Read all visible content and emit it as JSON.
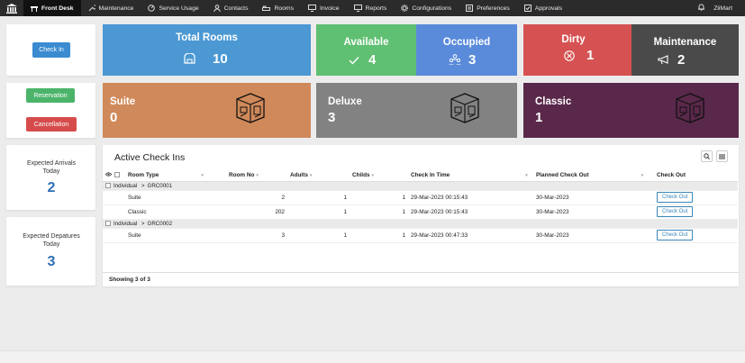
{
  "nav": {
    "items": [
      {
        "label": "Front Desk",
        "icon": "desk-icon"
      },
      {
        "label": "Maintenance",
        "icon": "wrench-icon"
      },
      {
        "label": "Service Usage",
        "icon": "gauge-icon"
      },
      {
        "label": "Contacts",
        "icon": "user-icon"
      },
      {
        "label": "Rooms",
        "icon": "bed-icon"
      },
      {
        "label": "Invoice",
        "icon": "monitor-icon"
      },
      {
        "label": "Reports",
        "icon": "monitor-icon"
      },
      {
        "label": "Configurations",
        "icon": "gear-icon"
      },
      {
        "label": "Preferences",
        "icon": "sliders-icon"
      },
      {
        "label": "Approvals",
        "icon": "checklist-icon"
      }
    ],
    "user": "ZliMart"
  },
  "actions": {
    "checkin": "Check In",
    "reservation": "Reservation",
    "cancellation": "Cancellation"
  },
  "stats": {
    "total_rooms": {
      "label": "Total Rooms",
      "value": "10"
    },
    "available": {
      "label": "Available",
      "value": "4"
    },
    "occupied": {
      "label": "Occupied",
      "value": "3"
    },
    "dirty": {
      "label": "Dirty",
      "value": "1"
    },
    "maintenance": {
      "label": "Maintenance",
      "value": "2"
    }
  },
  "room_types": {
    "suite": {
      "label": "Suite",
      "value": "0"
    },
    "deluxe": {
      "label": "Deluxe",
      "value": "3"
    },
    "classic": {
      "label": "Classic",
      "value": "1"
    }
  },
  "expected": {
    "arrivals_label": "Expected Arrivals Today",
    "arrivals_value": "2",
    "departures_label": "Expected Depatures Today",
    "departures_value": "3"
  },
  "checkins": {
    "title": "Active Check Ins",
    "columns": [
      "Room Type",
      "Room No",
      "Adults",
      "Childs",
      "Check In Time",
      "Planned Check Out",
      "Check Out"
    ],
    "groups": [
      {
        "label": "Individual",
        "sep": ">",
        "code": "GRC0001"
      },
      {
        "label": "Individual",
        "sep": ">",
        "code": "GRC0002"
      }
    ],
    "rows": [
      {
        "room_type": "Suite",
        "room_no": "2",
        "adults": "1",
        "childs": "1",
        "checkin": "29-Mar-2023 00:15:43",
        "planned": "30-Mar-2023",
        "action": "Check Out"
      },
      {
        "room_type": "Classic",
        "room_no": "202",
        "adults": "1",
        "childs": "1",
        "checkin": "29-Mar-2023 00:15:43",
        "planned": "30-Mar-2023",
        "action": "Check Out"
      },
      {
        "room_type": "Suite",
        "room_no": "3",
        "adults": "1",
        "childs": "1",
        "checkin": "29-Mar-2023 00:47:33",
        "planned": "30-Mar-2023",
        "action": "Check Out"
      }
    ],
    "footer": "Showing 3 of 3"
  },
  "colors": {
    "nav_bg": "#2b2b2b",
    "total": "#4b98d3",
    "available": "#5fbf72",
    "occupied": "#5a8bdb",
    "dirty": "#d65252",
    "maintenance": "#4a4a4a",
    "suite": "#d0895a",
    "deluxe": "#828282",
    "classic": "#5a284a",
    "btn_blue": "#3a8bd0",
    "btn_green": "#4cb46a",
    "btn_red": "#d64c4c"
  }
}
